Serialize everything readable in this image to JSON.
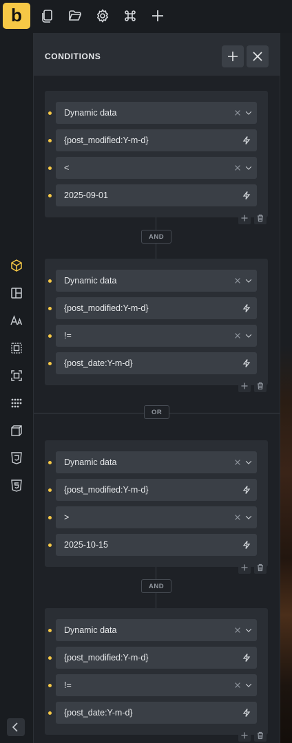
{
  "topbar": {
    "logo": "b",
    "icons": [
      "pages-icon",
      "folder-icon",
      "settings-gear-icon",
      "command-icon",
      "add-plus-icon"
    ]
  },
  "leftbar": {
    "icons": [
      "cube-icon",
      "layout-icon",
      "typography-icon",
      "spacing-icon",
      "sizing-icon",
      "dots-grid-icon",
      "transform-box-icon",
      "css3-icon",
      "html5-icon"
    ],
    "collapse": "chevron-left-icon"
  },
  "panel": {
    "title": "CONDITIONS",
    "add_label": "Add",
    "close_label": "Close"
  },
  "groups": [
    {
      "sets": [
        {
          "rows": [
            {
              "type": "select",
              "value": "Dynamic data"
            },
            {
              "type": "dynamic",
              "value": "{post_modified:Y-m-d}"
            },
            {
              "type": "select",
              "value": "<"
            },
            {
              "type": "dynamic",
              "value": "2025-09-01"
            }
          ]
        },
        {
          "rows": [
            {
              "type": "select",
              "value": "Dynamic data"
            },
            {
              "type": "dynamic",
              "value": "{post_modified:Y-m-d}"
            },
            {
              "type": "select",
              "value": "!="
            },
            {
              "type": "dynamic",
              "value": "{post_date:Y-m-d}"
            }
          ]
        }
      ]
    },
    {
      "sets": [
        {
          "rows": [
            {
              "type": "select",
              "value": "Dynamic data"
            },
            {
              "type": "dynamic",
              "value": "{post_modified:Y-m-d}"
            },
            {
              "type": "select",
              "value": ">"
            },
            {
              "type": "dynamic",
              "value": "2025-10-15"
            }
          ]
        },
        {
          "rows": [
            {
              "type": "select",
              "value": "Dynamic data"
            },
            {
              "type": "dynamic",
              "value": "{post_modified:Y-m-d}"
            },
            {
              "type": "select",
              "value": "!="
            },
            {
              "type": "dynamic",
              "value": "{post_date:Y-m-d}"
            }
          ]
        }
      ]
    }
  ],
  "relations": {
    "and": "AND",
    "or": "OR"
  },
  "colors": {
    "accent": "#f6c846",
    "panel": "#1e2126",
    "card": "#2a2e34",
    "field": "#3a3f46"
  }
}
